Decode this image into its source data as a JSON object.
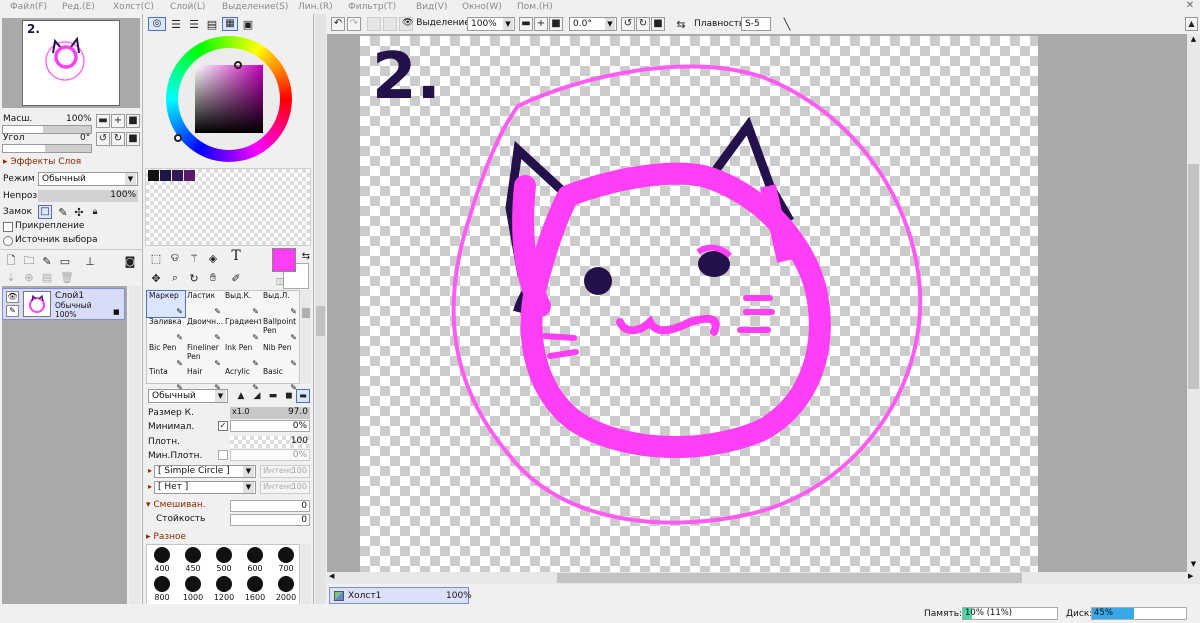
{
  "menu": [
    "Файл(F)",
    "Ред.(E)",
    "Холст(C)",
    "Слой(L)",
    "Выделение(S)",
    "Лин.(R)",
    "Фильтр(T)",
    "Вид(V)",
    "Окно(W)",
    "Пом.(H)"
  ],
  "navigator": {
    "thumb_text": "2.",
    "zoom_label": "Масш.",
    "zoom_value": "100%",
    "angle_label": "Угол",
    "angle_value": "0°"
  },
  "layer_effects": {
    "title": "Эффекты Слоя",
    "mode_label": "Режим",
    "mode_value": "Обычный",
    "opacity_label": "Непроз.",
    "opacity_value": "100%",
    "lock_label": "Замок",
    "clipping_label": "Прикрепление",
    "selection_source_label": "Источник выбора"
  },
  "layers": [
    {
      "name": "Слой1",
      "mode": "Обычный",
      "opacity": "100%"
    }
  ],
  "swatches": [
    "#111111",
    "#1e1446",
    "#2e1a55",
    "#5a1a66"
  ],
  "primary_color": "#ff3ef5",
  "brushes": [
    {
      "name": "Маркер",
      "selected": true
    },
    {
      "name": "Ластик"
    },
    {
      "name": "Выд.К."
    },
    {
      "name": "Выд.Л."
    },
    {
      "name": "Заливка"
    },
    {
      "name": "Двоичн..."
    },
    {
      "name": "Градиент"
    },
    {
      "name": "Ballpoint Pen"
    },
    {
      "name": "Bic Pen"
    },
    {
      "name": "Fineliner Pen"
    },
    {
      "name": "Ink Pen"
    },
    {
      "name": "Nib Pen"
    },
    {
      "name": "Tinta"
    },
    {
      "name": "Hair"
    },
    {
      "name": "Acrylic"
    },
    {
      "name": "Basic"
    }
  ],
  "brush_settings": {
    "blend_mode": "Обычный",
    "size_label": "Размер К.",
    "size_mult": "x1.0",
    "size_value": "97.0",
    "min_size_label": "Минимал.",
    "min_size_value": "0%",
    "density_label": "Плотн.",
    "density_value": "100",
    "min_density_label": "Мин.Плотн.",
    "min_density_value": "0%",
    "shape_value": "[ Simple Circle ]",
    "texture_value": "[ Нет ]",
    "intensity_label": "Интенс",
    "intensity_value": "100",
    "mixing_label": "Смешиван.",
    "mixing_value": "0",
    "persistence_label": "Стойкость",
    "persistence_value": "0",
    "misc_label": "Разное"
  },
  "brush_size_presets": [
    "400",
    "450",
    "500",
    "600",
    "700",
    "800",
    "1000",
    "1200",
    "1600",
    "2000"
  ],
  "canvas_toolbar": {
    "selection_label": "Выделение",
    "zoom_value": "100%",
    "angle_value": "0.0°",
    "stabilizer_label": "Плавность",
    "stabilizer_value": "S-5"
  },
  "canvas": {
    "number_text": "2."
  },
  "canvas_tab": {
    "name": "Холст1",
    "zoom": "100%"
  },
  "status": {
    "memory_label": "Память:",
    "memory_value": "10% (11%)",
    "memory_fraction": 0.1,
    "disk_label": "Диск:",
    "disk_value": "45%",
    "disk_fraction": 0.45
  }
}
